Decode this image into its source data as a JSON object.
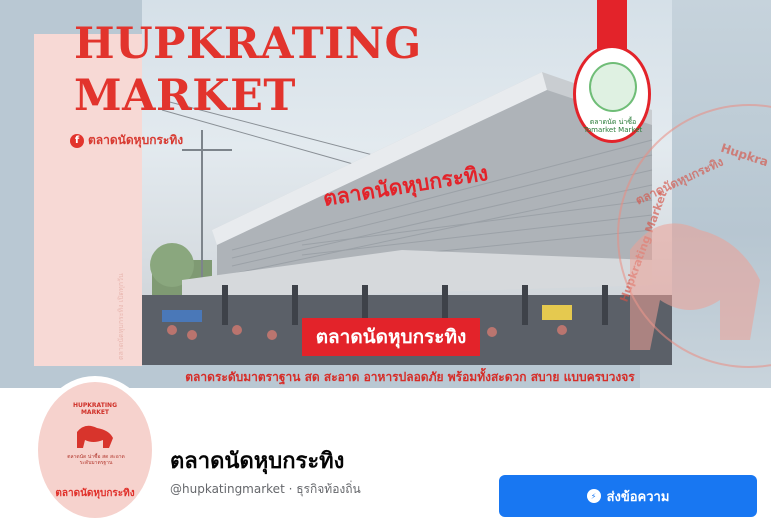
{
  "cover": {
    "title_line1": "HUPKRATING",
    "title_line2": "MARKET",
    "fb_icon": "f",
    "fb_label": "ตลาดนัดหุบกระทิง",
    "building_sign": "ตลาดนัดหุบกระทิง",
    "banner": "ตลาดนัดหุบกระทิง",
    "caption": "ตลาดระดับมาตราฐาน สด สะอาด อาหารปลอดภัย พร้อมทั้งสะดวก สบาย แบบครบวงจร",
    "logo_text": "ตลาดนัด น่าซื้อ",
    "logo_subtext": "Tomarket Market",
    "watermark_thai": "ตลาดนัดหุบกระทิง",
    "watermark_en": "Hupkrating Market",
    "watermark_en2": "Hupkra",
    "side_text": "ตลาดนัดหุบกระทิง เปิดทุกวัน",
    "accent_color": "#e3232a"
  },
  "profile": {
    "avatar_top": "HUPKRATING MARKET",
    "avatar_mid": "ตลาดนัด น่าซื้อ สด สะอาด ระดับมาตรฐาน",
    "avatar_name": "ตลาดนัดหุบกระทิง",
    "page_name": "ตลาดนัดหุบกระทิง",
    "meta": "@hupkatingmarket · ธุรกิจท้องถิ่น",
    "message_button": "ส่งข้อความ",
    "message_icon": "messenger-icon",
    "button_color": "#1877f2"
  }
}
